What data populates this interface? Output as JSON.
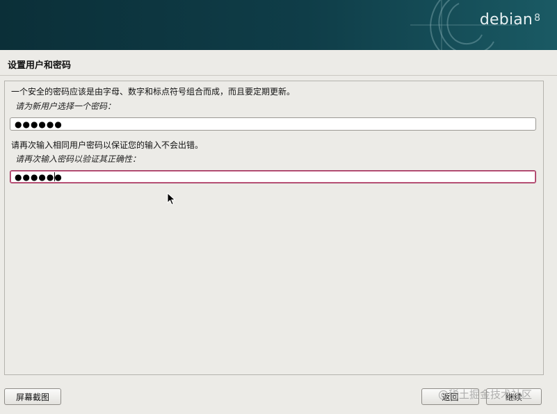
{
  "brand": {
    "name": "debian",
    "version": "8"
  },
  "page": {
    "title": "设置用户和密码"
  },
  "form": {
    "description1": "一个安全的密码应该是由字母、数字和标点符号组合而成，而且要定期更新。",
    "prompt1": "请为新用户选择一个密码：",
    "password1_value": "●●●●●●",
    "description2": "请再次输入相同用户密码以保证您的输入不会出错。",
    "prompt2": "请再次输入密码以验证其正确性：",
    "password2_value": "●●●●●●"
  },
  "buttons": {
    "screenshot": "屏幕截图",
    "back": "返回",
    "continue": "继续"
  },
  "watermark": "@稀土掘金技术社区",
  "colors": {
    "banner": "#0f3d48",
    "focus_border": "#a0315a",
    "background": "#ecebe7"
  }
}
